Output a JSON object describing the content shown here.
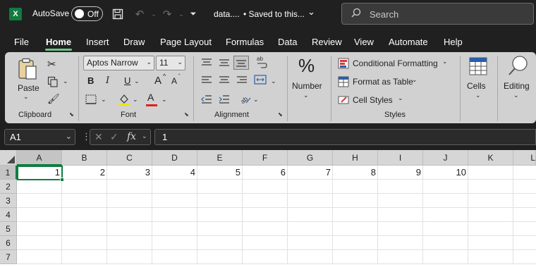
{
  "titlebar": {
    "logo_letter": "X",
    "autosave_label": "AutoSave",
    "autosave_state": "Off",
    "filename": "data....",
    "save_status": "• Saved to this...",
    "search_placeholder": "Search"
  },
  "menu": {
    "items": [
      "File",
      "Home",
      "Insert",
      "Draw",
      "Page Layout",
      "Formulas",
      "Data",
      "Review",
      "View",
      "Automate",
      "Help"
    ],
    "active": "Home"
  },
  "ribbon": {
    "clipboard": {
      "paste_label": "Paste",
      "group_label": "Clipboard"
    },
    "font": {
      "font_name": "Aptos Narrow",
      "font_size": "11",
      "bold": "B",
      "italic": "I",
      "underline": "U",
      "grow": "A",
      "shrink": "A",
      "color_letter": "A",
      "group_label": "Font"
    },
    "alignment": {
      "group_label": "Alignment"
    },
    "number": {
      "label": "Number",
      "percent": "%"
    },
    "styles": {
      "conditional_formatting": "Conditional Formatting",
      "format_as_table": "Format as Table",
      "cell_styles": "Cell Styles",
      "group_label": "Styles"
    },
    "cells": {
      "label": "Cells"
    },
    "editing": {
      "label": "Editing"
    },
    "colors": {
      "highlight": "#f2e400",
      "font_color": "#e0201b"
    }
  },
  "formula_bar": {
    "name_box": "A1",
    "fx": "fx",
    "value": "1"
  },
  "sheet": {
    "columns": [
      "A",
      "B",
      "C",
      "D",
      "E",
      "F",
      "G",
      "H",
      "I",
      "J",
      "K",
      "L"
    ],
    "rows": [
      "1",
      "2",
      "3",
      "4",
      "5",
      "6",
      "7"
    ],
    "row1_values": [
      "1",
      "2",
      "3",
      "4",
      "5",
      "6",
      "7",
      "8",
      "9",
      "10",
      "",
      ""
    ],
    "active_cell": "A1",
    "accent": "#107c41"
  }
}
